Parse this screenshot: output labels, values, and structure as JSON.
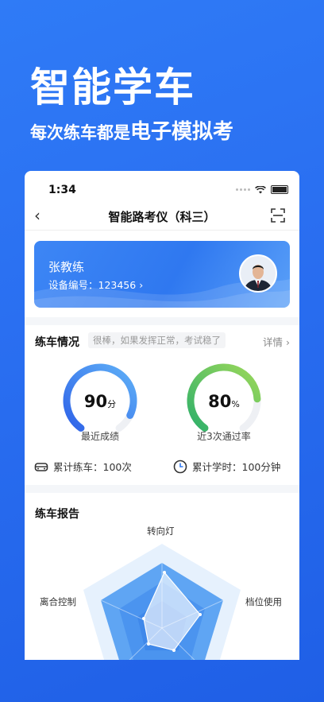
{
  "hero": {
    "title": "智能学车",
    "subtitle_prefix": "每次练车都是",
    "subtitle_emphasis": "电子模拟考"
  },
  "status_bar": {
    "time": "1:34"
  },
  "nav": {
    "title": "智能路考仪（科三）",
    "back_icon": "chevron-left-icon",
    "scan_icon": "scan-icon"
  },
  "coach_card": {
    "name": "张教练",
    "device": "设备编号：123456 ›"
  },
  "practice": {
    "title": "练车情况",
    "tip": "很棒，如果发挥正常，考试稳了",
    "detail": "详情 ›",
    "score": {
      "value": "90",
      "unit": "分",
      "label": "最近成绩",
      "fraction": 0.9
    },
    "pass_rate": {
      "value": "80",
      "unit": "%",
      "label": "近3次通过率",
      "fraction": 0.8
    },
    "total_practice": "累计练车：100次",
    "total_hours": "累计学时：100分钟"
  },
  "report": {
    "title": "练车报告",
    "axes": [
      "转向灯",
      "档位使用",
      "离合控制"
    ]
  },
  "colors": {
    "primary": "#2f78f0",
    "green": "#4cc36a"
  }
}
